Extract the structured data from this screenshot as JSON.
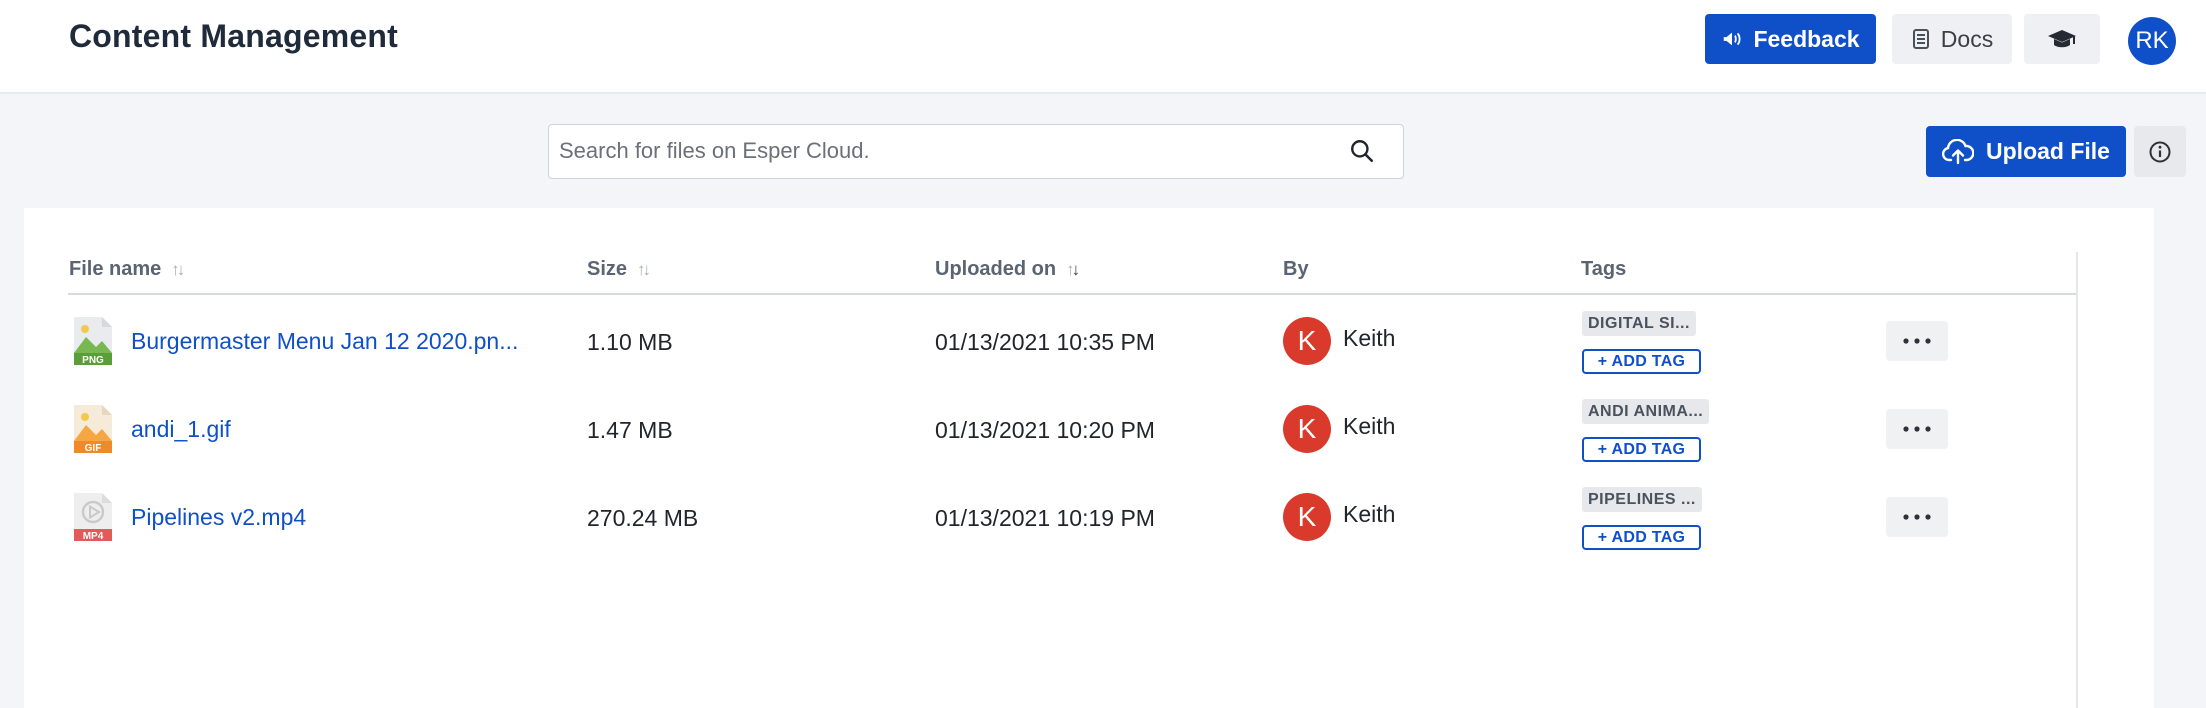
{
  "header": {
    "title": "Content Management",
    "feedback_label": "Feedback",
    "docs_label": "Docs",
    "user_initials": "RK",
    "icons": {
      "feedback": "megaphone-icon",
      "docs": "document-stack-icon",
      "learn": "graduation-cap-icon"
    }
  },
  "toolbar": {
    "search_placeholder": "Search for files on Esper Cloud.",
    "search_value": "",
    "upload_label": "Upload File"
  },
  "table": {
    "columns": {
      "file_name": "File name",
      "size": "Size",
      "uploaded_on": "Uploaded on",
      "by": "By",
      "tags": "Tags"
    },
    "sorted_column": "uploaded_on",
    "sort_direction": "desc",
    "add_tag_label": "+ ADD TAG",
    "rows": [
      {
        "file_name": "Burgermaster Menu Jan 12 2020.pn...",
        "file_type": "PNG",
        "size": "1.10 MB",
        "uploaded_on": "01/13/2021 10:35 PM",
        "by_initial": "K",
        "by_name": "Keith",
        "tag": "DIGITAL SI..."
      },
      {
        "file_name": "andi_1.gif",
        "file_type": "GIF",
        "size": "1.47 MB",
        "uploaded_on": "01/13/2021 10:20 PM",
        "by_initial": "K",
        "by_name": "Keith",
        "tag": "ANDI ANIMA..."
      },
      {
        "file_name": "Pipelines v2.mp4",
        "file_type": "MP4",
        "size": "270.24 MB",
        "uploaded_on": "01/13/2021 10:19 PM",
        "by_initial": "K",
        "by_name": "Keith",
        "tag": "PIPELINES ..."
      }
    ]
  },
  "colors": {
    "primary": "#0f50c8",
    "avatar_red": "#d93a2b",
    "png_green": "#5a9e3a",
    "gif_orange": "#ee8a2a",
    "mp4_red": "#e25a5a"
  }
}
